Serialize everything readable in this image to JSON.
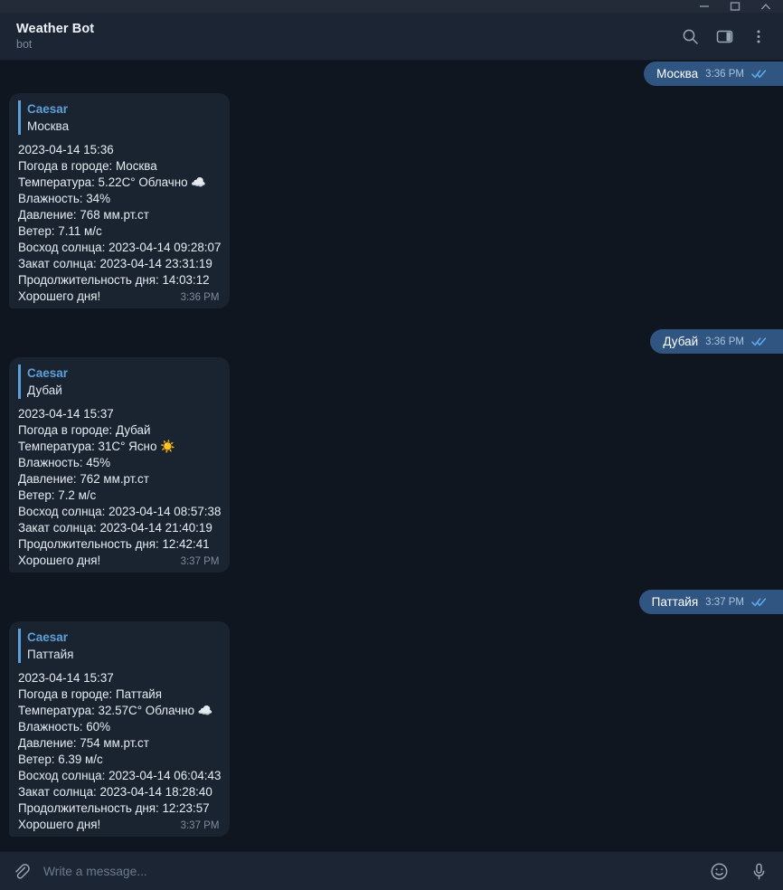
{
  "window": {
    "buttons": [
      {
        "name": "minimize",
        "glyph": "minimize-icon"
      },
      {
        "name": "maximize",
        "glyph": "maximize-icon"
      },
      {
        "name": "close",
        "glyph": "close-icon"
      }
    ]
  },
  "header": {
    "title": "Weather Bot",
    "subtitle": "bot",
    "actions": [
      {
        "name": "search-icon",
        "label": "Search"
      },
      {
        "name": "panel-icon",
        "label": "Toggle panel"
      },
      {
        "name": "more-menu-icon",
        "label": "More"
      }
    ]
  },
  "colors": {
    "titlebar_bg": "#232b38",
    "header_bg": "#1c2533",
    "chat_bg": "#0f1620",
    "bubble_in_bg": "#1a2430",
    "bubble_out_bg": "#2f5580",
    "accent_blue": "#5d9fd8",
    "tick_blue": "#5fa8e8",
    "text_primary": "#e6ecf2",
    "text_muted": "#7d8b9a"
  },
  "messages": [
    {
      "direction": "out",
      "text": "Москва",
      "time": "3:36 PM",
      "status": "read"
    },
    {
      "direction": "in",
      "quote": {
        "author": "Caesar",
        "text": "Москва"
      },
      "lines": [
        "2023-04-14 15:36",
        "Погода в городе: Москва",
        "Температура: 5.22C° Облачно ☁️",
        "Влажность: 34%",
        "Давление: 768 мм.рт.ст",
        "Ветер: 7.11 м/с",
        "Восход солнца: 2023-04-14 09:28:07",
        "Закат солнца: 2023-04-14 23:31:19",
        "Продолжительность дня: 14:03:12",
        "Хорошего дня!"
      ],
      "time": "3:36 PM"
    },
    {
      "direction": "out",
      "text": "Дубай",
      "time": "3:36 PM",
      "status": "read"
    },
    {
      "direction": "in",
      "quote": {
        "author": "Caesar",
        "text": "Дубай"
      },
      "lines": [
        "2023-04-14 15:37",
        "Погода в городе: Дубай",
        "Температура: 31C° Ясно ☀️",
        "Влажность: 45%",
        "Давление: 762 мм.рт.ст",
        "Ветер: 7.2 м/с",
        "Восход солнца: 2023-04-14 08:57:38",
        "Закат солнца: 2023-04-14 21:40:19",
        "Продолжительность дня: 12:42:41",
        "Хорошего дня!"
      ],
      "time": "3:37 PM"
    },
    {
      "direction": "out",
      "text": "Паттайя",
      "time": "3:37 PM",
      "status": "read"
    },
    {
      "direction": "in",
      "quote": {
        "author": "Caesar",
        "text": "Паттайя"
      },
      "lines": [
        "2023-04-14 15:37",
        "Погода в городе: Паттайя",
        "Температура: 32.57C° Облачно ☁️",
        "Влажность: 60%",
        "Давление: 754 мм.рт.ст",
        "Ветер: 6.39 м/с",
        "Восход солнца: 2023-04-14 06:04:43",
        "Закат солнца: 2023-04-14 18:28:40",
        "Продолжительность дня: 12:23:57",
        "Хорошего дня!"
      ],
      "time": "3:37 PM"
    }
  ],
  "composer": {
    "attach_icon": "paperclip-icon",
    "placeholder": "Write a message...",
    "value": "",
    "emoji_icon": "emoji-icon",
    "mic_icon": "microphone-icon"
  }
}
